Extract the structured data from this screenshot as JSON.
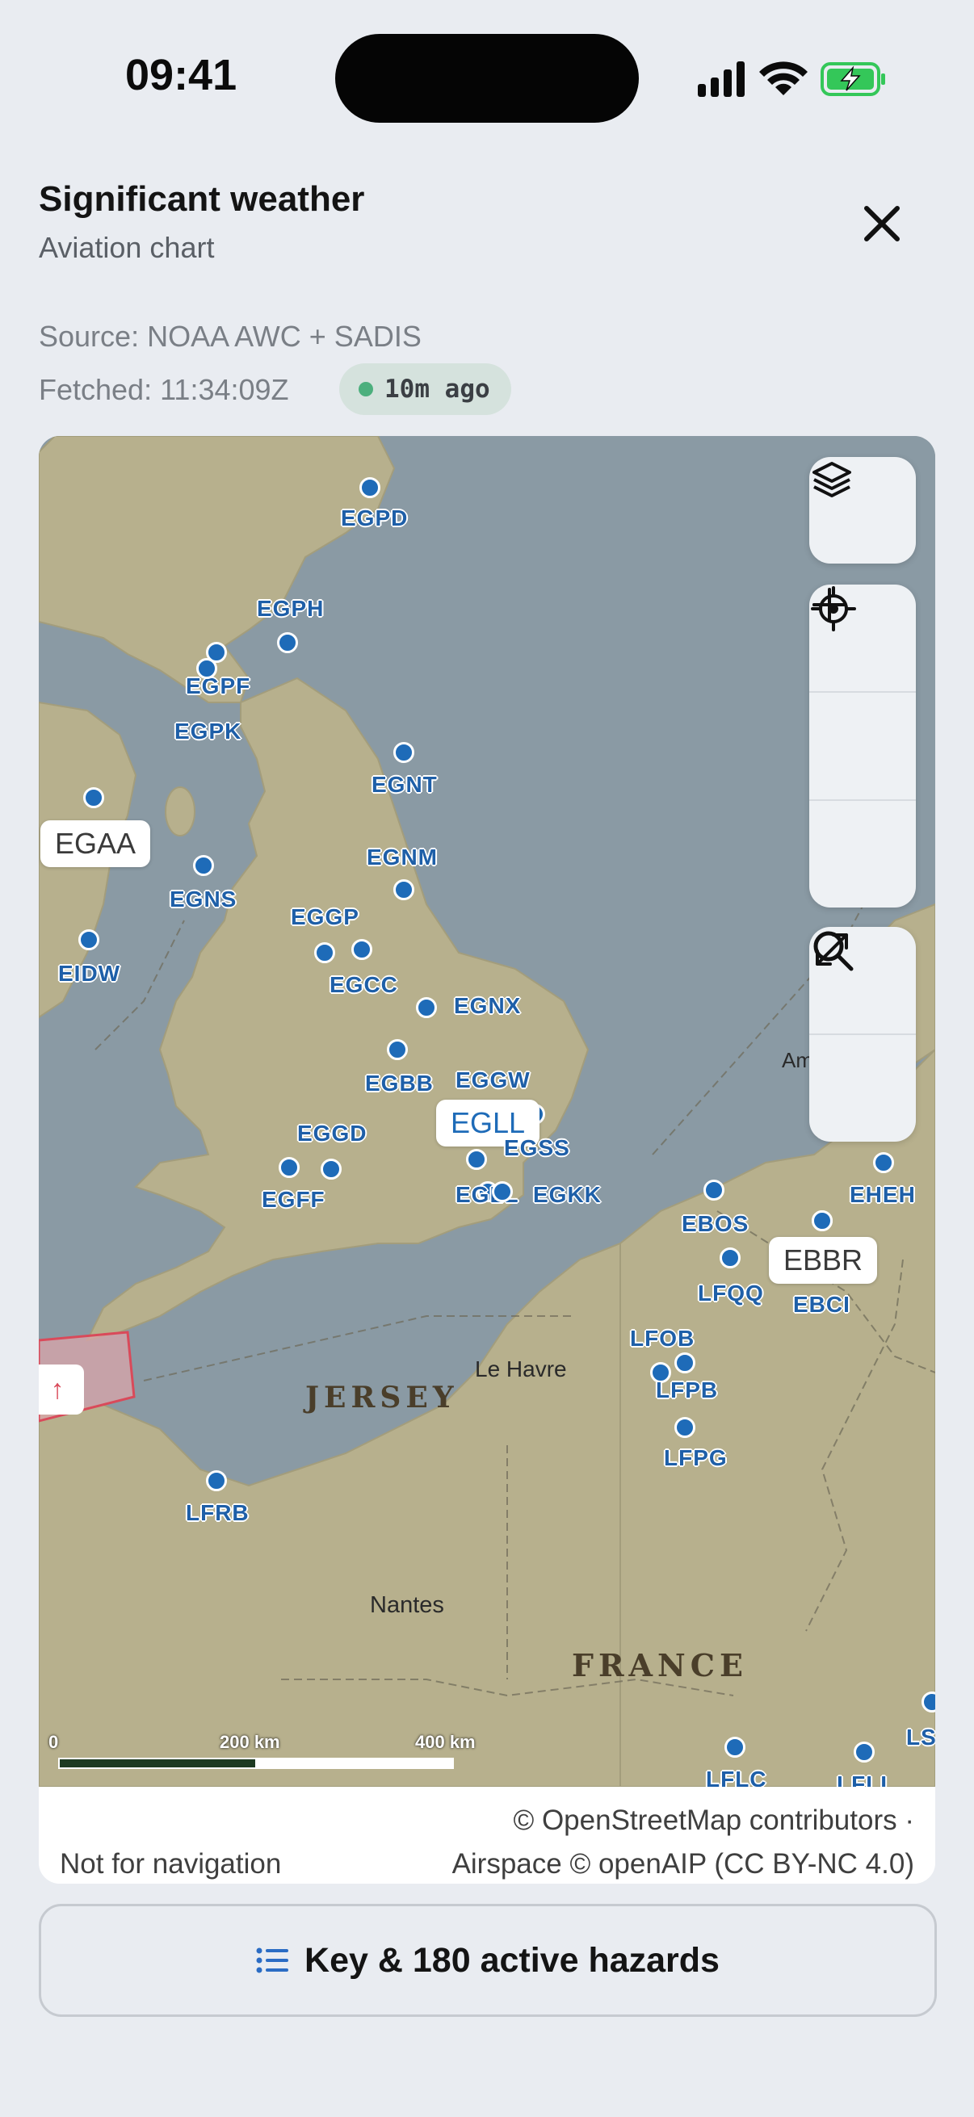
{
  "status_bar": {
    "time": "09:41"
  },
  "header": {
    "title": "Significant weather",
    "subtitle": "Aviation chart",
    "close_icon": "close-icon"
  },
  "meta": {
    "source": "Source: NOAA AWC + SADIS",
    "fetched": "Fetched: 11:34:09Z",
    "age": "10m ago",
    "age_color": "#4caf7d"
  },
  "map": {
    "airports": [
      "EGPD",
      "EGPH",
      "EGPF",
      "EGPK",
      "EGNT",
      "EGAA",
      "EGNM",
      "EGNS",
      "EGGP",
      "EIDW",
      "EGCC",
      "EGNX",
      "EGBB",
      "EGGW",
      "EGLL",
      "EGGD",
      "EGSS",
      "EGFF",
      "EGLL",
      "EGKK",
      "EBOS",
      "EHEH",
      "EBBR",
      "LFQQ",
      "EBCI",
      "LFOB",
      "LFPB",
      "LFPG",
      "LFRB",
      "LFLC",
      "LFLL",
      "LSGG"
    ],
    "places": [
      "JERSEY",
      "Le Havre",
      "Nantes",
      "FRANCE",
      "Am"
    ],
    "scale": {
      "zero": "0",
      "mid": "200 km",
      "end": "400 km"
    },
    "hazard_arrow": "↑",
    "controls": [
      "layers-icon",
      "zoom-in-icon",
      "zoom-out-icon",
      "locate-icon",
      "search-icon",
      "expand-icon"
    ]
  },
  "attribution": {
    "line1": "© OpenStreetMap contributors ·",
    "line2": "Airspace © openAIP (CC BY-NC 4.0)",
    "disclaimer": "Not for navigation"
  },
  "key_button": {
    "label": "Key & 180 active hazards",
    "icon": "list-icon"
  },
  "colors": {
    "airport": "#1e6bb8",
    "accent": "#2b6cc4",
    "hazard": "#d94a5a"
  }
}
